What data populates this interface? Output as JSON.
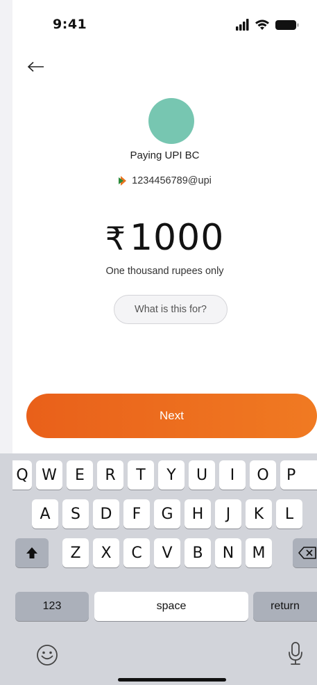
{
  "status": {
    "time": "9:41"
  },
  "payee": {
    "name": "Paying UPI BC",
    "upi_id": "1234456789@upi"
  },
  "amount": {
    "currency_symbol": "₹",
    "value": "1000",
    "words": "One thousand rupees only"
  },
  "note": {
    "placeholder": "What is this for?"
  },
  "next_button": {
    "label": "Next"
  },
  "keyboard": {
    "row1": [
      "Q",
      "W",
      "E",
      "R",
      "T",
      "Y",
      "U",
      "I",
      "O",
      "P"
    ],
    "row2": [
      "A",
      "S",
      "D",
      "F",
      "G",
      "H",
      "J",
      "K",
      "L"
    ],
    "row3": [
      "Z",
      "X",
      "C",
      "V",
      "B",
      "N",
      "M"
    ],
    "numbers": "123",
    "space": "space",
    "return": "return"
  },
  "colors": {
    "accent": "#ea6a1f",
    "avatar": "#77c6b1"
  }
}
